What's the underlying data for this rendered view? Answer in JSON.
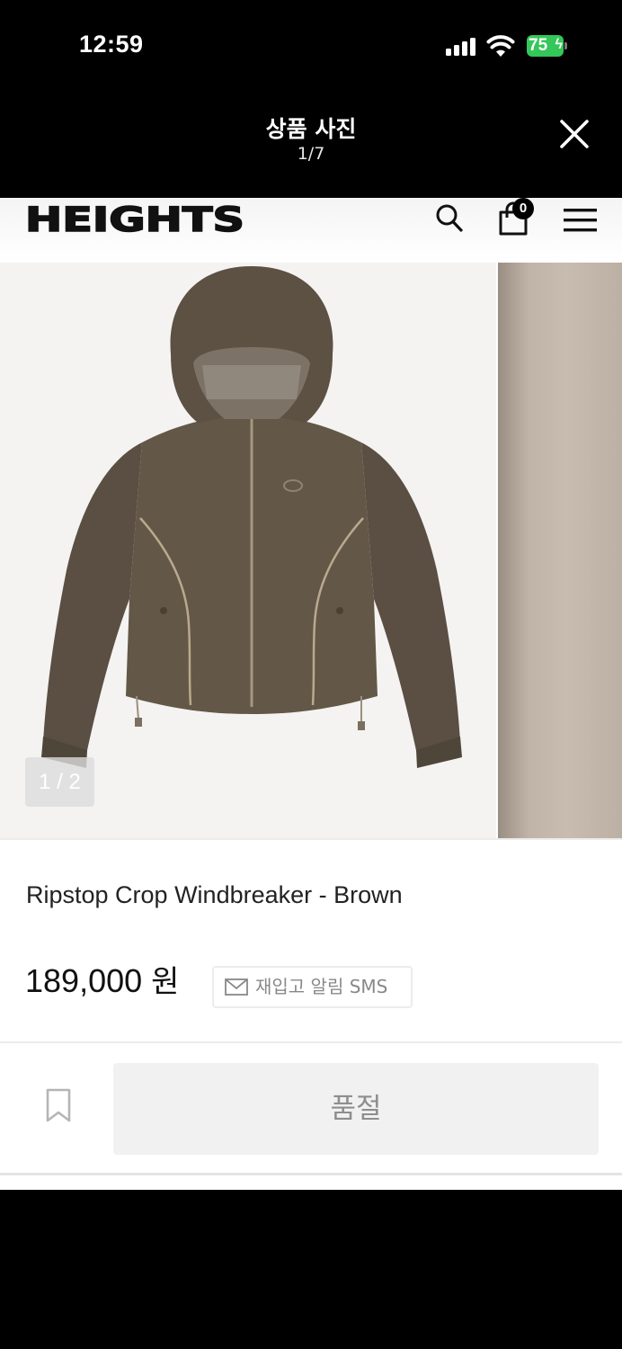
{
  "status_bar": {
    "time": "12:59",
    "battery_level": "75",
    "battery_color": "#34c759"
  },
  "viewer": {
    "title": "상품 사진",
    "counter": "1/7",
    "close_icon": "close-icon"
  },
  "site": {
    "logo_text": "HEIGHTS",
    "cart_count": "0",
    "icons": [
      "search-icon",
      "cart-icon",
      "menu-icon"
    ]
  },
  "gallery": {
    "slide_counter": "1 / 2",
    "image_subject": "brown ripstop hooded windbreaker"
  },
  "product": {
    "name": "Ripstop Crop Windbreaker - Brown",
    "price": "189,000",
    "currency": "원",
    "restock_label": "재입고 알림 SMS",
    "soldout_label": "품절"
  }
}
